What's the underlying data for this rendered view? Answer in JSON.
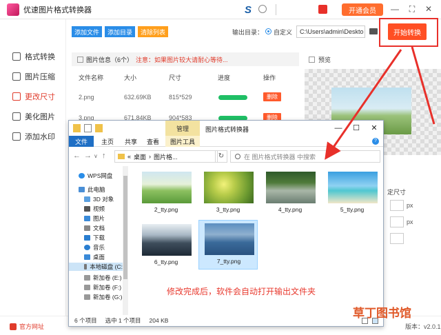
{
  "app": {
    "title": "优速图片格式转换器",
    "vip_label": "开通会员",
    "start_button": "开始转换",
    "version": "版本：v2.0.1"
  },
  "sidebar": {
    "items": [
      {
        "label": "图片格式转换",
        "short": "格式转换"
      },
      {
        "label": "图片压缩",
        "short": "图片压缩"
      },
      {
        "label": "更改尺寸",
        "short": "更改尺寸"
      },
      {
        "label": "美化图片",
        "short": "美化图片"
      },
      {
        "label": "添加水印",
        "short": "添加水印"
      }
    ]
  },
  "toolbar": {
    "add_file": "添加文件",
    "add_dir": "添加目录",
    "clear_list": "清除列表",
    "output_label": "输出目录：",
    "custom_label": "自定义",
    "output_path": "C:\\Users\\admin\\Deskto"
  },
  "file_panel": {
    "header": "图片信息（6个）",
    "notice": "注意：如果图片较大请耐心等待...",
    "columns": [
      "文件名称",
      "大小",
      "尺寸",
      "进度",
      "操作"
    ],
    "rows": [
      {
        "name": "2.png",
        "size": "632.69KB",
        "dims": "815*529",
        "action": "删除"
      },
      {
        "name": "3.png",
        "size": "671.84KB",
        "dims": "904*583",
        "action": "删除"
      }
    ]
  },
  "preview": {
    "header": "预览",
    "size_label": "定尺寸",
    "unit": "px"
  },
  "bottom": {
    "site": "官方网址"
  },
  "explorer": {
    "manage_tab": "管理",
    "title": "图片格式转换器",
    "ribbon": [
      "文件",
      "主页",
      "共享",
      "查看",
      "图片工具"
    ],
    "address": [
      "«",
      "桌面",
      "›",
      "图片格..."
    ],
    "search_placeholder": "在 图片格式转换器 中搜索",
    "nav": [
      "WPS网盘",
      "此电脑",
      "3D 对象",
      "视频",
      "图片",
      "文档",
      "下载",
      "音乐",
      "桌面",
      "本地磁盘 (C:",
      "新加卷 (E:)",
      "新加卷 (F:)",
      "新加卷 (G:)"
    ],
    "files": [
      "2_tty.png",
      "3_tty.png",
      "4_tty.png",
      "5_tty.png",
      "6_tty.png",
      "7_tty.png"
    ],
    "status": {
      "count": "6 个项目",
      "selected": "选中 1 个项目",
      "size": "204 KB"
    }
  },
  "annotation": "修改完成后，软件会自动打开输出文件夹",
  "watermark": "草丁图书馆",
  "colors": {
    "accent_red": "#e8302a",
    "start_orange": "#ff4f24",
    "progress_green": "#1fbf65",
    "btn_blue": "#2a8de8"
  }
}
